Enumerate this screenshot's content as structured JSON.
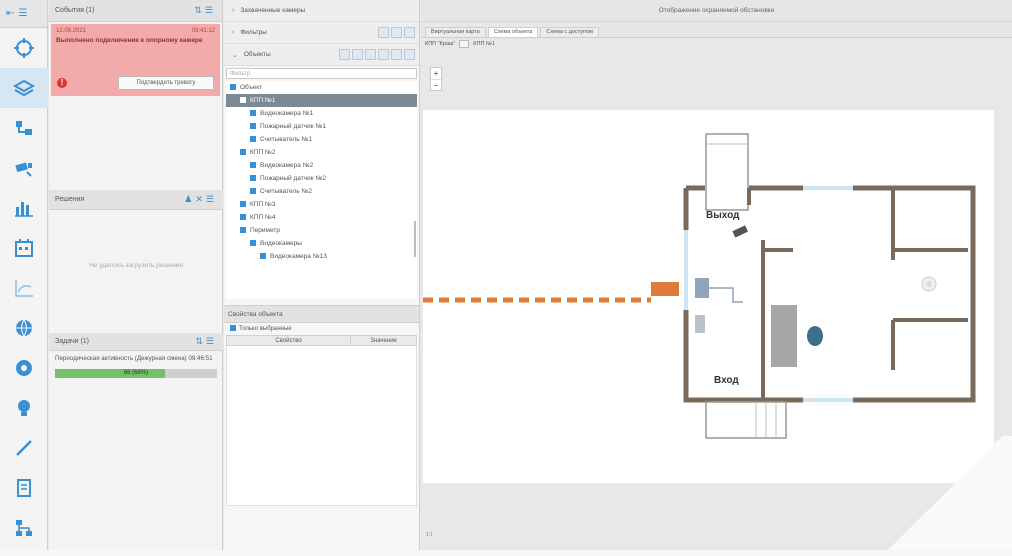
{
  "iconbar": {
    "top_icons": [
      "arrow-left-icon",
      "list-icon"
    ],
    "items": [
      {
        "icon": "crosshair-icon",
        "active": false
      },
      {
        "icon": "layers-icon",
        "active": true
      },
      {
        "icon": "route-icon",
        "active": false
      },
      {
        "icon": "camera-icon",
        "active": false
      },
      {
        "icon": "bar-chart-icon",
        "active": false
      },
      {
        "icon": "calendar-icon",
        "active": false
      },
      {
        "icon": "line-chart-icon",
        "active": false
      },
      {
        "icon": "globe-icon",
        "active": false
      },
      {
        "icon": "target-icon",
        "active": false
      },
      {
        "icon": "bulb-icon",
        "active": false
      },
      {
        "icon": "pen-icon",
        "active": false
      },
      {
        "icon": "document-icon",
        "active": false
      },
      {
        "icon": "network-icon",
        "active": false
      }
    ]
  },
  "events": {
    "header": "События (1)",
    "alarm": {
      "date": "12.08.2021",
      "time": "09:41:12",
      "title": "Выполнено подключение к опорному камере",
      "confirm_label": "Подтвердить тревогу"
    }
  },
  "solutions": {
    "header": "Решения",
    "empty_text": "Не удалось загрузить решения"
  },
  "tasks": {
    "header": "Задачи (1)",
    "task_text": "Периодическая активность (Дежурная смена) 09:46:51",
    "progress": 0.68,
    "progress_label": "68 (68%)"
  },
  "tree_panel": {
    "sections": [
      {
        "label": "Захваченные камеры",
        "collapsed": true
      },
      {
        "label": "Фильтры",
        "collapsed": true
      },
      {
        "label": "Объекты",
        "collapsed": false
      }
    ],
    "filter_placeholder": "Фильтр",
    "nodes": [
      {
        "label": "Объект",
        "level": 0,
        "selected": false
      },
      {
        "label": "КПП №1",
        "level": 1,
        "selected": true
      },
      {
        "label": "Видеокамера №1",
        "level": 2,
        "selected": false
      },
      {
        "label": "Пожарный датчик №1",
        "level": 2,
        "selected": false
      },
      {
        "label": "Считыватель №1",
        "level": 2,
        "selected": false
      },
      {
        "label": "КПП №2",
        "level": 1,
        "selected": false
      },
      {
        "label": "Видеокамера №2",
        "level": 2,
        "selected": false
      },
      {
        "label": "Пожарный датчик №2",
        "level": 2,
        "selected": false
      },
      {
        "label": "Считыватель №2",
        "level": 2,
        "selected": false
      },
      {
        "label": "КПП №3",
        "level": 1,
        "selected": false
      },
      {
        "label": "КПП №4",
        "level": 1,
        "selected": false
      },
      {
        "label": "Периметр",
        "level": 1,
        "selected": false
      },
      {
        "label": "Видеокамеры",
        "level": 2,
        "selected": false
      },
      {
        "label": "Видеокамера №13",
        "level": 3,
        "selected": false
      }
    ],
    "props_header": "Свойства объекта",
    "only_selected": "Только выбранные",
    "col_property": "Свойство",
    "col_value": "Значение"
  },
  "main": {
    "title": "Отображение охраняемой обстановки",
    "tabs": [
      {
        "label": "Виртуальная карта",
        "active": false
      },
      {
        "label": "Схема объекта",
        "active": true
      },
      {
        "label": "Схема с доступом",
        "active": false
      }
    ],
    "crumb_root": "КПП \"Краш\"",
    "crumb_item": "КПП №1",
    "zoom_in": "+",
    "zoom_out": "−",
    "scale_text": "1:1",
    "plan": {
      "label_exit": "Выход",
      "label_entry": "Вход"
    }
  },
  "colors": {
    "accent": "#3a8fd0",
    "alarm_bg": "#f3aaaa",
    "wall": "#7a6a5c",
    "barrier": "#e07a3a"
  }
}
